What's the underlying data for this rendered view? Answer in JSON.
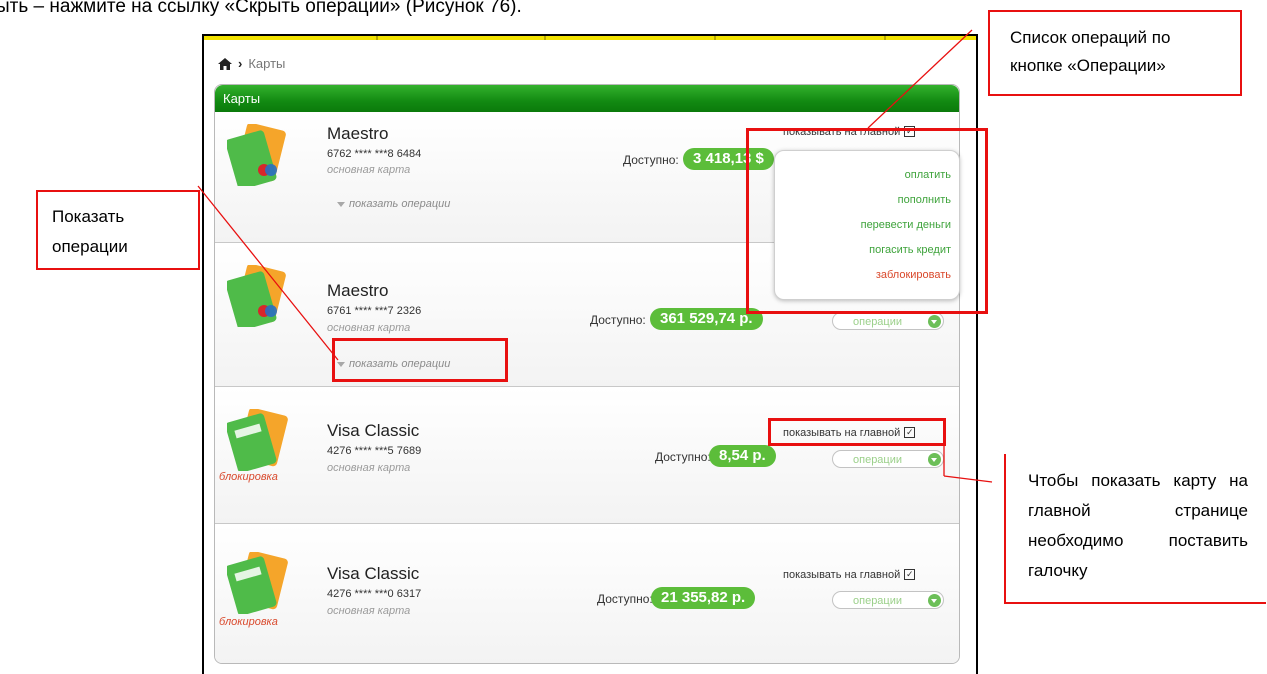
{
  "document": {
    "text_line": "ыть – нажмите на ссылку «Скрыть операции» (Рисунок 76)."
  },
  "breadcrumb": {
    "home_icon": "home-icon",
    "separator": "›",
    "current": "Карты"
  },
  "panel": {
    "title": "Карты"
  },
  "cards": [
    {
      "name": "Maestro",
      "number": "6762 **** ***8 6484",
      "kind": "основная карта",
      "show_operations": "показать операции",
      "available_label": "Доступно:",
      "available_amount": "3 418,13 $",
      "show_on_main": "показывать на главной",
      "show_on_main_checked": true,
      "block_label": ""
    },
    {
      "name": "Maestro",
      "number": "6761 **** ***7 2326",
      "kind": "основная карта",
      "show_operations": "показать операции",
      "available_label": "Доступно:",
      "available_amount": "361 529,74 р.",
      "operations_button": "операции",
      "block_label": ""
    },
    {
      "name": "Visa Classic",
      "number": "4276 **** ***5 7689",
      "kind": "основная карта",
      "available_label": "Доступно:",
      "available_amount": "8,54 р.",
      "show_on_main": "показывать на главной",
      "show_on_main_checked": true,
      "operations_button": "операции",
      "block_label": "блокировка"
    },
    {
      "name": "Visa Classic",
      "number": "4276 **** ***0 6317",
      "kind": "основная карта",
      "available_label": "Доступно:",
      "available_amount": "21 355,82 р.",
      "show_on_main": "показывать на главной",
      "show_on_main_checked": true,
      "operations_button": "операции",
      "block_label": "блокировка"
    }
  ],
  "operations_menu": {
    "items": [
      "оплатить",
      "пополнить",
      "перевести деньги",
      "погасить кредит",
      "заблокировать"
    ]
  },
  "annotations": {
    "operations_list": "Список операций по кнопке «Операции»",
    "show_operations": "Показать операции",
    "show_on_main": "Чтобы показать карту на главной странице необходимо поставить галочку"
  },
  "colors": {
    "header_green": "#128a12",
    "amount_green": "#5cbd3a",
    "menu_green": "#3ea33b",
    "block_red": "#d9482b",
    "annotation_red": "#e81010",
    "top_bar_yellow": "#f2e200"
  }
}
